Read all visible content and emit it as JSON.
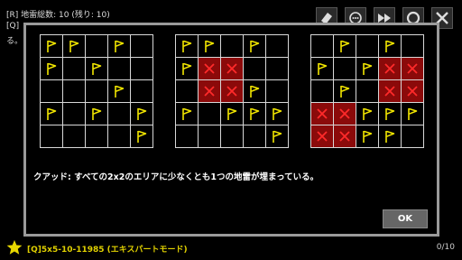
{
  "header": {
    "line1": "[R] 地雷総数: 10 (残り: 10)",
    "line2": "[Q]",
    "line3": "る。"
  },
  "toolbar": [
    {
      "name": "eraser-icon"
    },
    {
      "name": "hint-icon"
    },
    {
      "name": "fast-forward-icon"
    },
    {
      "name": "circle-icon"
    },
    {
      "name": "close-icon"
    }
  ],
  "examples": [
    {
      "cells": [
        [
          "F",
          "F",
          "",
          "F",
          ""
        ],
        [
          "F",
          "",
          "F",
          "",
          ""
        ],
        [
          "",
          "",
          "",
          "F",
          ""
        ],
        [
          "F",
          "",
          "F",
          "",
          "F"
        ],
        [
          "",
          "",
          "",
          "",
          "F"
        ]
      ]
    },
    {
      "cells": [
        [
          "F",
          "F",
          "",
          "F",
          ""
        ],
        [
          "F",
          "X",
          "X",
          "",
          ""
        ],
        [
          "",
          "X",
          "X",
          "F",
          ""
        ],
        [
          "F",
          "",
          "F",
          "F",
          "F"
        ],
        [
          "",
          "",
          "",
          "",
          "F"
        ]
      ]
    },
    {
      "cells": [
        [
          "",
          "F",
          "",
          "F",
          ""
        ],
        [
          "F",
          "",
          "F",
          "X",
          "X"
        ],
        [
          "",
          "F",
          "",
          "X",
          "X"
        ],
        [
          "X",
          "X",
          "F",
          "F",
          "F"
        ],
        [
          "X",
          "X",
          "F",
          "F",
          ""
        ]
      ]
    }
  ],
  "dialog": {
    "rule_text": "クアッド: すべての2x2のエリアに少なくとも1つの地雷が埋まっている。",
    "ok_label": "OK"
  },
  "footer": {
    "puzzle_id": "[Q]5x5-10-11985 (エキスパートモード)",
    "progress": "0/10"
  },
  "colors": {
    "flag": "#f2e600",
    "mine_bg": "#8b0a0a",
    "mine_x": "#ff2a2a",
    "star": "#e8d800"
  }
}
